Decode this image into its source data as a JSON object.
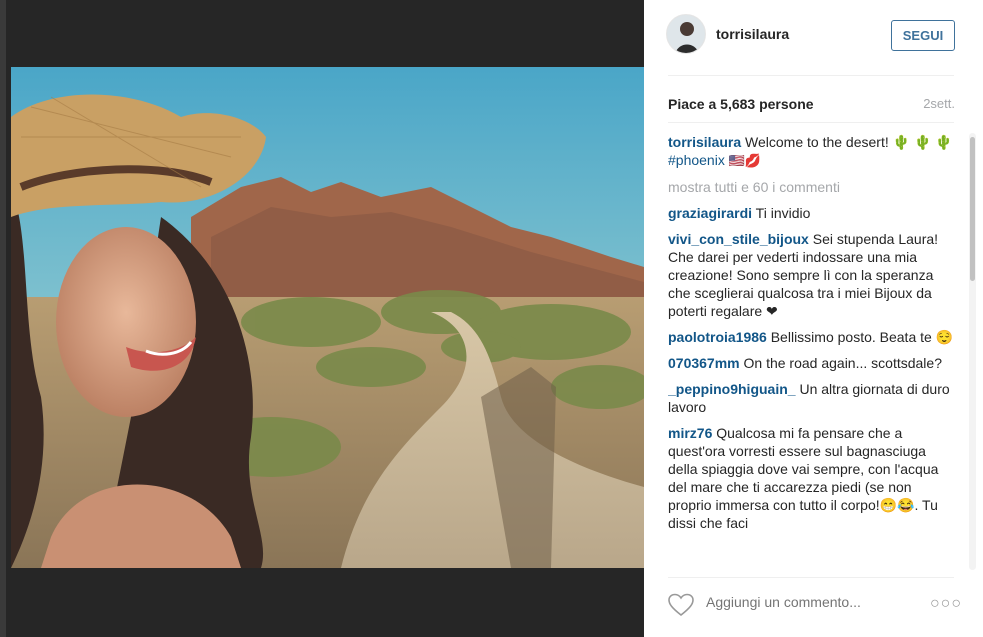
{
  "post": {
    "username": "torrisilaura",
    "follow_label": "SEGUI",
    "likes_text": "Piace a 5,683 persone",
    "time_text": "2sett.",
    "caption": {
      "username": "torrisilaura",
      "text": "Welcome to the desert! 🌵 🌵 🌵",
      "hashtag": "#phoenix",
      "emoji": "🇺🇸💋"
    },
    "view_all_text": "mostra tutti e 60 i commenti",
    "comments": [
      {
        "username": "graziagirardi",
        "text": "Ti invidio"
      },
      {
        "username": "vivi_con_stile_bijoux",
        "text": "Sei stupenda Laura! Che darei per vederti indossare una mia creazione! Sono sempre lì con la speranza che sceglierai qualcosa tra i miei Bijoux da poterti regalare ❤"
      },
      {
        "username": "paolotroia1986",
        "text": "Bellissimo posto. Beata te 😌"
      },
      {
        "username": "070367mm",
        "text": "On the road again... scottsdale?"
      },
      {
        "username": "_peppino9higuain_",
        "text": "Un altra giornata di duro lavoro"
      },
      {
        "username": "mirz76",
        "text": "Qualcosa mi fa pensare che a quest'ora vorresti essere sul bagnasciuga della spiaggia dove vai sempre, con l'acqua del mare che ti accarezza piedi (se non proprio immersa con tutto il corpo!😁😂. Tu dissi che faci"
      }
    ],
    "add_comment_placeholder": "Aggiungi un commento...",
    "more_options": "○○○"
  },
  "icons": {
    "heart": "heart-outline-icon",
    "avatar": "user-avatar",
    "more": "more-options-icon"
  },
  "colors": {
    "link": "#125688",
    "follow": "#3f729b",
    "muted": "#a5a7aa"
  }
}
